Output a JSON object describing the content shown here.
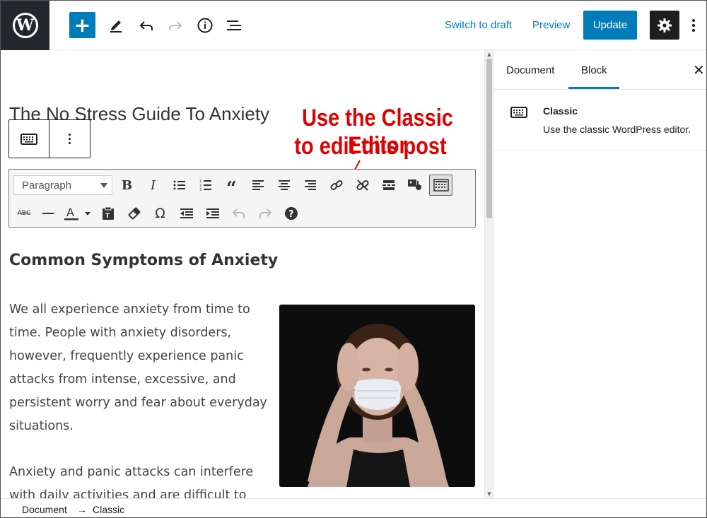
{
  "topbar": {
    "switch_to_draft": "Switch to draft",
    "preview": "Preview",
    "update": "Update",
    "add_symbol": "+"
  },
  "post": {
    "title": "The No Stress Guide To Anxiety",
    "heading": "Common Symptoms of Anxiety",
    "para1_lines": [
      "We all experience anxiety from time to",
      "time. People with anxiety disorders,",
      "however, frequently experience panic",
      "attacks from intense, excessive, and",
      "persistent worry and fear about everyday",
      "situations."
    ],
    "para2_lines": [
      "Anxiety and panic attacks can interfere",
      "with daily activities and are difficult to"
    ]
  },
  "classic_toolbar": {
    "format_value": "Paragraph",
    "icons_row1": [
      "bold-icon",
      "italic-icon",
      "bulleted-list-icon",
      "numbered-list-icon",
      "blockquote-icon",
      "align-left-icon",
      "align-center-icon",
      "align-right-icon",
      "insert-link-icon",
      "remove-link-icon",
      "read-more-icon",
      "add-media-icon",
      "toolbar-toggle-icon"
    ],
    "icons_row2": [
      "strikethrough-icon",
      "horizontal-line-icon",
      "text-color-icon",
      "paste-as-text-icon",
      "clear-formatting-icon",
      "special-character-icon",
      "decrease-indent-icon",
      "increase-indent-icon",
      "undo-icon",
      "redo-icon",
      "help-icon"
    ]
  },
  "annotation": {
    "line1": "Use the Classic Editor",
    "line2": "to edit this post",
    "color": "#e00000"
  },
  "sidebar": {
    "tabs": [
      "Document",
      "Block"
    ],
    "active_tab": "Block",
    "block_title": "Classic",
    "block_description": "Use the classic WordPress editor."
  },
  "breadcrumb": {
    "items": [
      "Document",
      "Classic"
    ],
    "separator": "→"
  },
  "colors": {
    "accent": "#007cba",
    "dark": "#1e1e1e",
    "logo_bg": "#23282d"
  }
}
